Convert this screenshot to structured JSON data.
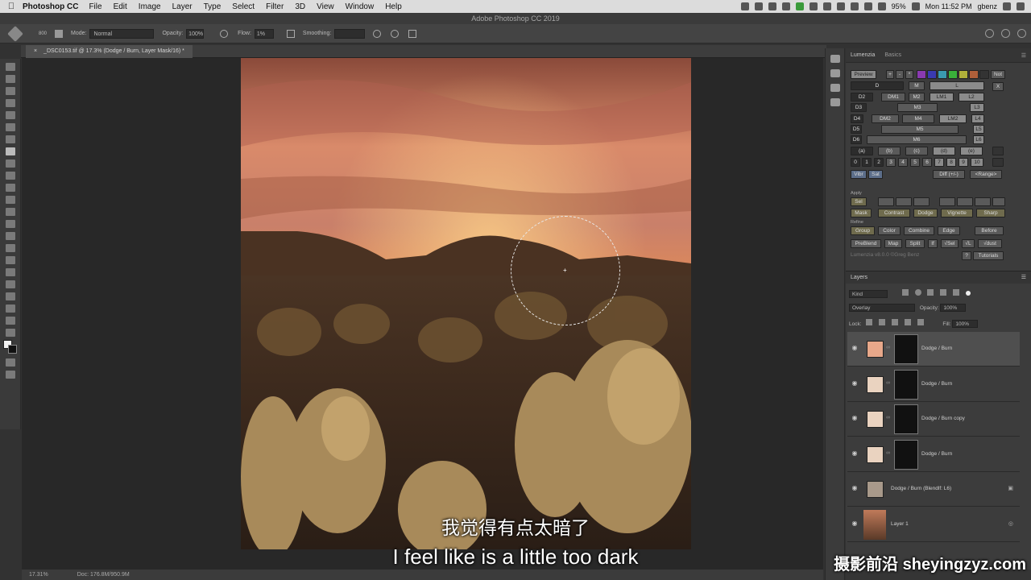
{
  "menubar": {
    "apple": "",
    "app": "Photoshop CC",
    "items": [
      "File",
      "Edit",
      "Image",
      "Layer",
      "Type",
      "Select",
      "Filter",
      "3D",
      "View",
      "Window",
      "Help"
    ],
    "battery": "95%",
    "time": "Mon 11:52 PM",
    "user": "gbenz"
  },
  "window_title": "Adobe Photoshop CC 2019",
  "options": {
    "brush_size": "800",
    "mode_label": "Mode:",
    "mode_value": "Normal",
    "opacity_label": "Opacity:",
    "opacity_value": "100%",
    "flow_label": "Flow:",
    "flow_value": "1%",
    "smoothing_label": "Smoothing:"
  },
  "document_tab": "_DSC0153.tif @ 17.3% (Dodge / Burn, Layer Mask/16) *",
  "status": {
    "zoom": "17.31%",
    "doc": "Doc: 176.8M/950.9M"
  },
  "subtitles": {
    "chinese": "我觉得有点太暗了",
    "english": "I feel like is a little too dark"
  },
  "watermark": "摄影前沿 sheyingzyz.com",
  "panel_tabs": [
    "Lumenzia",
    "Basics"
  ],
  "lumenzia": {
    "preview": "Preview",
    "plus": "+",
    "minus": "-",
    "star": "*",
    "not": "Not",
    "x": "X",
    "row_d": [
      "D",
      "M",
      "L"
    ],
    "row_2": [
      "D2",
      "DM1",
      "M2",
      "LM1",
      "L2"
    ],
    "row_3": [
      "D3",
      "M3",
      "L3"
    ],
    "row_4": [
      "D4",
      "DM2",
      "M4",
      "LM2",
      "L4"
    ],
    "row_5": [
      "D5",
      "M5",
      "L5"
    ],
    "row_6": [
      "D6",
      "M6",
      "L6"
    ],
    "zones": [
      "(a)",
      "(b)",
      "(c)",
      "(d)",
      "(e)"
    ],
    "numbers": [
      "0",
      "1",
      "2",
      "3",
      "4",
      "5",
      "6",
      "7",
      "8",
      "9",
      "10"
    ],
    "vibr": "Vibr",
    "sat": "Sat",
    "diff": "Diff (+/-)",
    "range": "<Range>",
    "apply_label": "Apply",
    "sel": "Sel",
    "mask": "Mask",
    "contrast": "Contrast",
    "dodge": "Dodge",
    "vignette": "Vignette",
    "sharp": "Sharp",
    "refine_label": "Refine",
    "group": "Group",
    "color": "Color",
    "combine": "Combine",
    "edge": "Edge",
    "before": "Before",
    "preblend": "PreBlend",
    "map": "Map",
    "split": "Split",
    "if": "If",
    "vsel": "√Sel",
    "vl": "√L",
    "vdust": "√dust",
    "credit": "Lumenzia v8.0.0 ©Greg Benz",
    "help": "?",
    "tutorials": "Tutorials"
  },
  "layers_panel": {
    "title": "Layers",
    "kind": "Kind",
    "blend_mode": "Overlay",
    "opacity_label": "Opacity:",
    "opacity_value": "100%",
    "lock_label": "Lock:",
    "fill_label": "Fill:",
    "fill_value": "100%",
    "layers": [
      {
        "name": "Dodge / Burn",
        "swatch": "#e8a88a",
        "selected": true
      },
      {
        "name": "Dodge / Burn",
        "swatch": "#ead3c0",
        "selected": false
      },
      {
        "name": "Dodge / Burn copy",
        "swatch": "#ead3c0",
        "selected": false
      },
      {
        "name": "Dodge / Burn",
        "swatch": "#ead3c0",
        "selected": false
      },
      {
        "name": "Dodge / Burn (Blendlf: L6)",
        "swatch": "#a8998a",
        "selected": false
      },
      {
        "name": "Layer 1",
        "swatch": "#9a6a4a",
        "selected": false
      }
    ]
  }
}
